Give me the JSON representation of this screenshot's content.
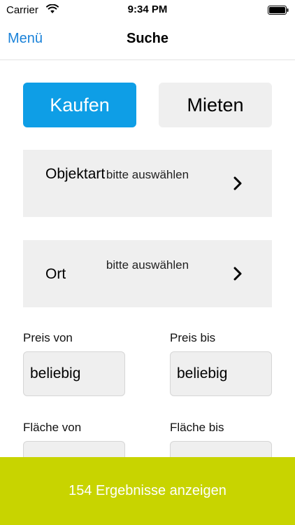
{
  "status_bar": {
    "carrier": "Carrier",
    "time": "9:34 PM"
  },
  "nav": {
    "back_label": "Menü",
    "title": "Suche"
  },
  "mode": {
    "buy_label": "Kaufen",
    "rent_label": "Mieten",
    "selected": "Kaufen"
  },
  "filters": {
    "objektart": {
      "label": "Objektart",
      "value": "bitte auswählen"
    },
    "ort": {
      "label": "Ort",
      "value": "bitte auswählen"
    }
  },
  "price": {
    "from_label": "Preis von",
    "from_value": "beliebig",
    "to_label": "Preis bis",
    "to_value": "beliebig"
  },
  "area": {
    "from_label": "Fläche von",
    "from_value": "",
    "to_label": "Fläche bis",
    "to_value": ""
  },
  "results": {
    "button_label": "154 Ergebnisse anzeigen"
  },
  "colors": {
    "accent_blue": "#0e9ee6",
    "link_blue": "#1a82d9",
    "action_green": "#c8d400",
    "field_gray": "#efefef"
  },
  "icons": [
    "wifi-icon",
    "battery-icon",
    "chevron-right-icon"
  ]
}
